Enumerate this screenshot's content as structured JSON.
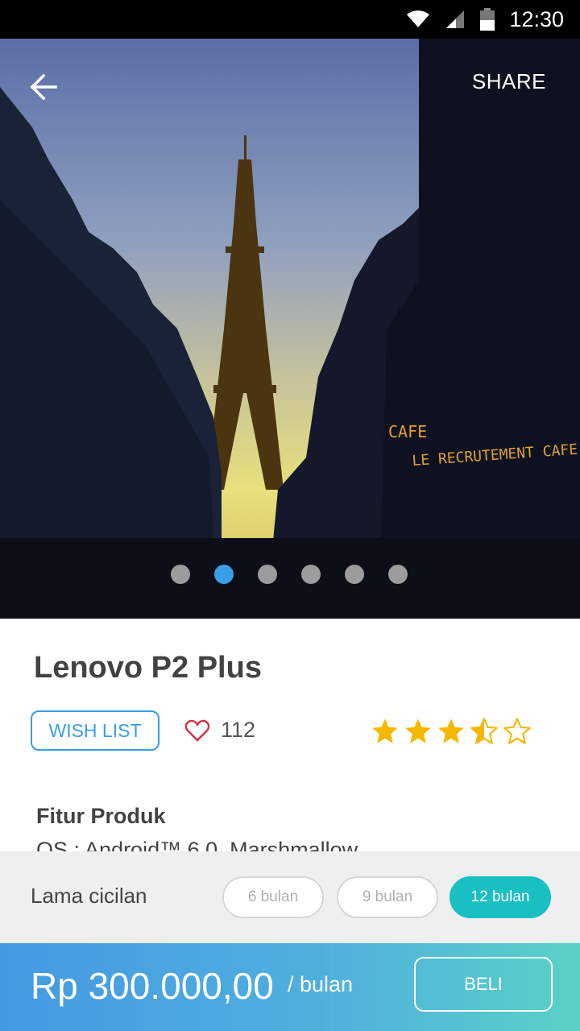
{
  "status_bar": {
    "time": "12:30"
  },
  "header": {
    "back_icon": "arrow-left-icon",
    "share_label": "SHARE"
  },
  "hero": {
    "image_alt": "Eiffel Tower at dusk seen down a Paris street",
    "sign_text_1": "CAFE",
    "sign_text_2": "LE RECRUTEMENT  CAFE",
    "carousel_count": 6,
    "carousel_active_index": 1
  },
  "product": {
    "title": "Lenovo P2 Plus",
    "wishlist_label": "WISH LIST",
    "likes": "112",
    "rating": 3.5,
    "rating_max": 5,
    "features_title": "Fitur Produk",
    "features_first_line": "OS : Android™ 6.0, Marshmallow"
  },
  "installment": {
    "label": "Lama cicilan",
    "options": [
      "6 bulan",
      "9 bulan",
      "12 bulan"
    ],
    "selected": "12 bulan"
  },
  "checkout": {
    "price": "Rp 300.000,00",
    "unit": "/ bulan",
    "buy_label": "BELI"
  },
  "colors": {
    "accent": "#3a9ee6",
    "teal": "#19bfc1",
    "star": "#f5b800",
    "heart": "#d32f3f"
  }
}
